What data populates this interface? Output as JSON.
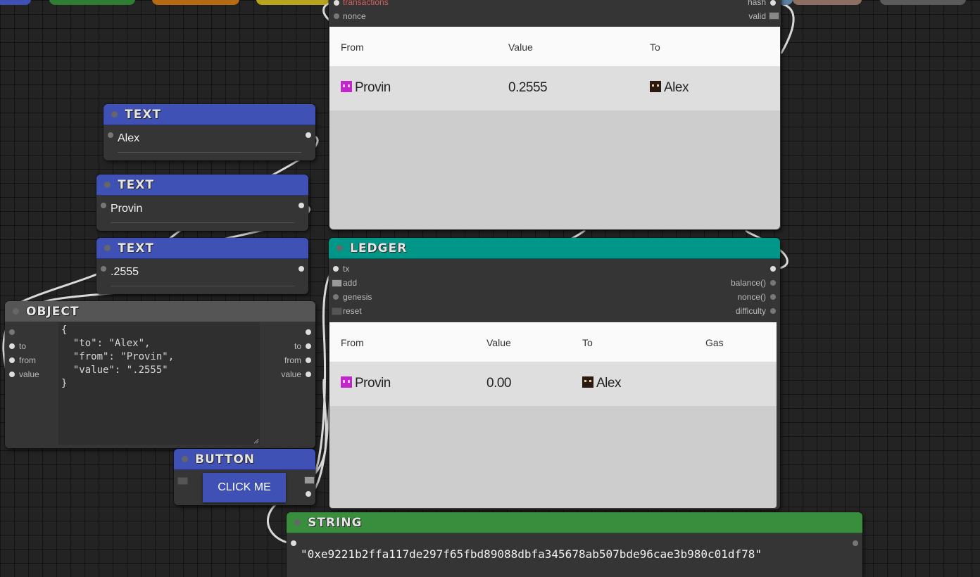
{
  "top_partial_node": {
    "left_slots": [
      "transactions",
      "nonce"
    ],
    "right_slots": [
      "hash",
      "valid"
    ],
    "table": {
      "headers": [
        "From",
        "Value",
        "To"
      ],
      "row": {
        "from": "Provin",
        "value": "0.2555",
        "to": "Alex"
      }
    }
  },
  "text_nodes": [
    {
      "title": "TEXT",
      "value": "Alex"
    },
    {
      "title": "TEXT",
      "value": "Provin"
    },
    {
      "title": "TEXT",
      "value": ".2555"
    }
  ],
  "object_node": {
    "title": "OBJECT",
    "inputs": [
      "to",
      "from",
      "value"
    ],
    "outputs": [
      "to",
      "from",
      "value"
    ],
    "json_text": "{\n  \"to\": \"Alex\",\n  \"from\": \"Provin\",\n  \"value\": \".2555\"\n}"
  },
  "button_node": {
    "title": "BUTTON",
    "label": "CLICK ME"
  },
  "ledger_node": {
    "title": "LEDGER",
    "inputs": [
      "tx",
      "add",
      "genesis",
      "reset"
    ],
    "outputs": [
      "balance()",
      "nonce()",
      "difficulty"
    ],
    "table": {
      "headers": [
        "From",
        "Value",
        "To",
        "Gas"
      ],
      "row": {
        "from": "Provin",
        "value": "0.00",
        "to": "Alex",
        "gas": ""
      }
    }
  },
  "string_node": {
    "title": "STRING",
    "value": "\"0xe9221b2ffa117de297f65fbd89088dbfa345678ab507bde96cae3b980c01df78\""
  },
  "colors": {
    "canvas": "#232323",
    "text_header": "#3f51b5",
    "ledger_header": "#009688",
    "object_header": "#555555",
    "string_header": "#388e3c",
    "provin_avatar": "#c026c9",
    "alex_avatar": "#2a1a12"
  }
}
